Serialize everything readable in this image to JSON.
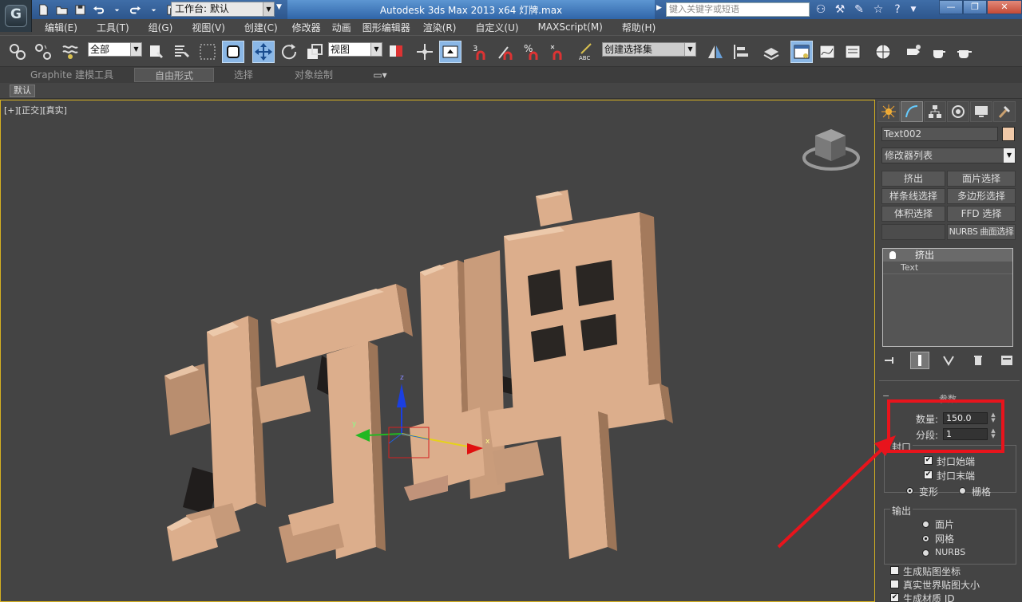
{
  "window": {
    "title": "Autodesk 3ds Max  2013 x64      灯牌.max",
    "workspace_label": "工作台: 默认",
    "search_placeholder": "键入关键字或短语"
  },
  "menu": [
    "编辑(E)",
    "工具(T)",
    "组(G)",
    "视图(V)",
    "创建(C)",
    "修改器",
    "动画",
    "图形编辑器",
    "渲染(R)",
    "自定义(U)",
    "MAXScript(M)",
    "帮助(H)"
  ],
  "toolbar": {
    "selection_filter": "全部",
    "ref_coord": "视图",
    "snap_angle": "3",
    "snap_percent": "%",
    "named_selection": "创建选择集",
    "abc_label": "ABC"
  },
  "ribbon": {
    "tabs": [
      "Graphite 建模工具",
      "自由形式",
      "选择",
      "对象绘制"
    ],
    "active_tab": "自由形式",
    "sub_chip": "默认"
  },
  "viewport": {
    "label": "[+][正交][真实]",
    "text3d": "灯牌",
    "axis_x": "x",
    "axis_y": "y",
    "axis_z": "z"
  },
  "colors": {
    "text_face": "#dcae8c",
    "text_side": "#b98e6f",
    "text_shadow": "#8d6c55",
    "highlight": "#e8141c",
    "viewport_border": "#d4b021"
  },
  "panel": {
    "object_name": "Text002",
    "modifier_list": "修改器列表",
    "quick_buttons": [
      "挤出",
      "面片选择",
      "样条线选择",
      "多边形选择",
      "体积选择",
      "FFD 选择",
      "",
      "NURBS 曲面选择"
    ],
    "stack": [
      "挤出",
      "Text"
    ],
    "params_title": "参数",
    "amount_label": "数量:",
    "amount_value": "150.0",
    "segments_label": "分段:",
    "segments_value": "1",
    "capping_title": "封口",
    "cap_start": "封口始端",
    "cap_end": "封口末端",
    "morph": "变形",
    "grid": "栅格",
    "output_title": "输出",
    "out_patch": "面片",
    "out_mesh": "网格",
    "out_nurbs": "NURBS",
    "gen_map": "生成贴图坐标",
    "real_world": "真实世界贴图大小",
    "gen_matid": "生成材质 ID"
  }
}
